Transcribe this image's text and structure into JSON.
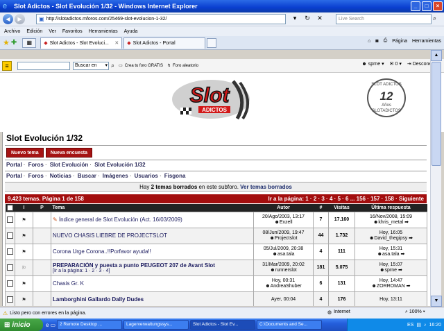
{
  "window": {
    "title": "Slot Adictos - Slot Evolución 1/32 - Windows Internet Explorer",
    "address": "http://slotadictos.mforos.com/25469-slot-evolucion-1-32/",
    "search_placeholder": "Live Search"
  },
  "menu": [
    "Archivo",
    "Edición",
    "Ver",
    "Favoritos",
    "Herramientas",
    "Ayuda"
  ],
  "tabs": [
    {
      "label": "Slot Adictos - Slot Evoluci...",
      "active": true
    },
    {
      "label": "Slot Adictos - Portal",
      "active": false
    }
  ],
  "commandbar": {
    "page": "Página",
    "tools": "Herramientas"
  },
  "forumbar": {
    "search_option": "Buscar en",
    "create_forum": "Crea tu foro GRATIS",
    "random_forum": "Foro aleatorio",
    "user": "sprne",
    "messages": "0",
    "logout": "Desconectar"
  },
  "banner": {
    "logo_main": "Slot",
    "logo_sub": "ADICTOS",
    "badge_top": "SLOT ADICTOS",
    "badge_number": "12",
    "badge_years": "Años",
    "badge_bottom": "SLOTADICTOS"
  },
  "page": {
    "title": "Slot Evolución 1/32",
    "new_topic": "Nuevo tema",
    "new_poll": "Nueva encuesta",
    "breadcrumb": [
      "Portal",
      "Foros",
      "Slot Evolución",
      "Slot Evolución 1/32"
    ],
    "nav": [
      "Portal",
      "Foros",
      "Noticias",
      "Buscar",
      "Imágenes",
      "Usuarios",
      "Fisgona"
    ],
    "notice_pre": "Hay",
    "notice_bold": "2 temas borrados",
    "notice_mid": "en este subforo.",
    "notice_link": "Ver temas borrados",
    "pagination_left": "9.423 temas. Página 1 de 158",
    "pagination_right": "Ir a la página: 1 · 2 · 3 · 4 · 5 · 6 ... 156 · 157 · 158 · Siguiente"
  },
  "table": {
    "headers": [
      "",
      "I",
      "P",
      "Tema",
      "Autor",
      "#",
      "Visitas",
      "Última respuesta"
    ],
    "rows": [
      {
        "title": "Índice general de Slot Evolución (Act. 16/03/2009)",
        "bold": false,
        "pages": "",
        "date": "20/Ago/2003, 13:17",
        "author": "Exzell",
        "replies": "7",
        "views": "17.160",
        "last_date": "16/Nov/2008, 15:09",
        "last_user": "khris_metal"
      },
      {
        "title": "NUEVO CHASIS LIEBRE DE PROJECTSLOT",
        "bold": false,
        "pages": "",
        "date": "08/Jun/2009, 19:47",
        "author": "Projectslot",
        "replies": "44",
        "views": "1.732",
        "last_date": "Hoy, 16:05",
        "last_user": "David_thegipsy"
      },
      {
        "title": "Corona Urge Corona..!!Porfavor ayuda!!",
        "bold": false,
        "pages": "",
        "date": "05/Jul/2009, 20:38",
        "author": "asa.tala",
        "replies": "4",
        "views": "111",
        "last_date": "Hoy, 15:31",
        "last_user": "asa.tala"
      },
      {
        "title": "PREPARACIÓN y puesta a punto PEUGEOT 207 de Avant Slot",
        "bold": true,
        "pages": "[Ir a la página: 1 · 2 · 3 · 4]",
        "date": "31/Mar/2009, 20:02",
        "author": "runnerslot",
        "replies": "181",
        "views": "5.075",
        "last_date": "Hoy, 15:07",
        "last_user": "sprne"
      },
      {
        "title": "Chasis Gr. K",
        "bold": false,
        "pages": "",
        "date": "Hoy, 00:31",
        "author": "AndreaShuber",
        "replies": "6",
        "views": "131",
        "last_date": "Hoy, 14:47",
        "last_user": "ZORROMAN"
      },
      {
        "title": "Lamborghini Gallardo Dally Dudes",
        "bold": false,
        "pages": "",
        "date": "Ayer, 00:04",
        "author": "",
        "replies": "4",
        "views": "176",
        "last_date": "Hoy, 13:11",
        "last_user": ""
      }
    ]
  },
  "status": {
    "text": "Listo pero con errores en la página.",
    "zone": "Internet",
    "zoom": "100%"
  },
  "taskbar": {
    "start": "inicio",
    "tasks": [
      "2 Remote Desktop ...",
      "Lagerverwaltungssys...",
      "Slot Adictos - Slot Ev...",
      "C:\\Documents and Se..."
    ],
    "lang": "ES",
    "clock": "16:20"
  },
  "colors": {
    "accent_red": "#a51313",
    "ie_blue": "#0a3fd0"
  }
}
